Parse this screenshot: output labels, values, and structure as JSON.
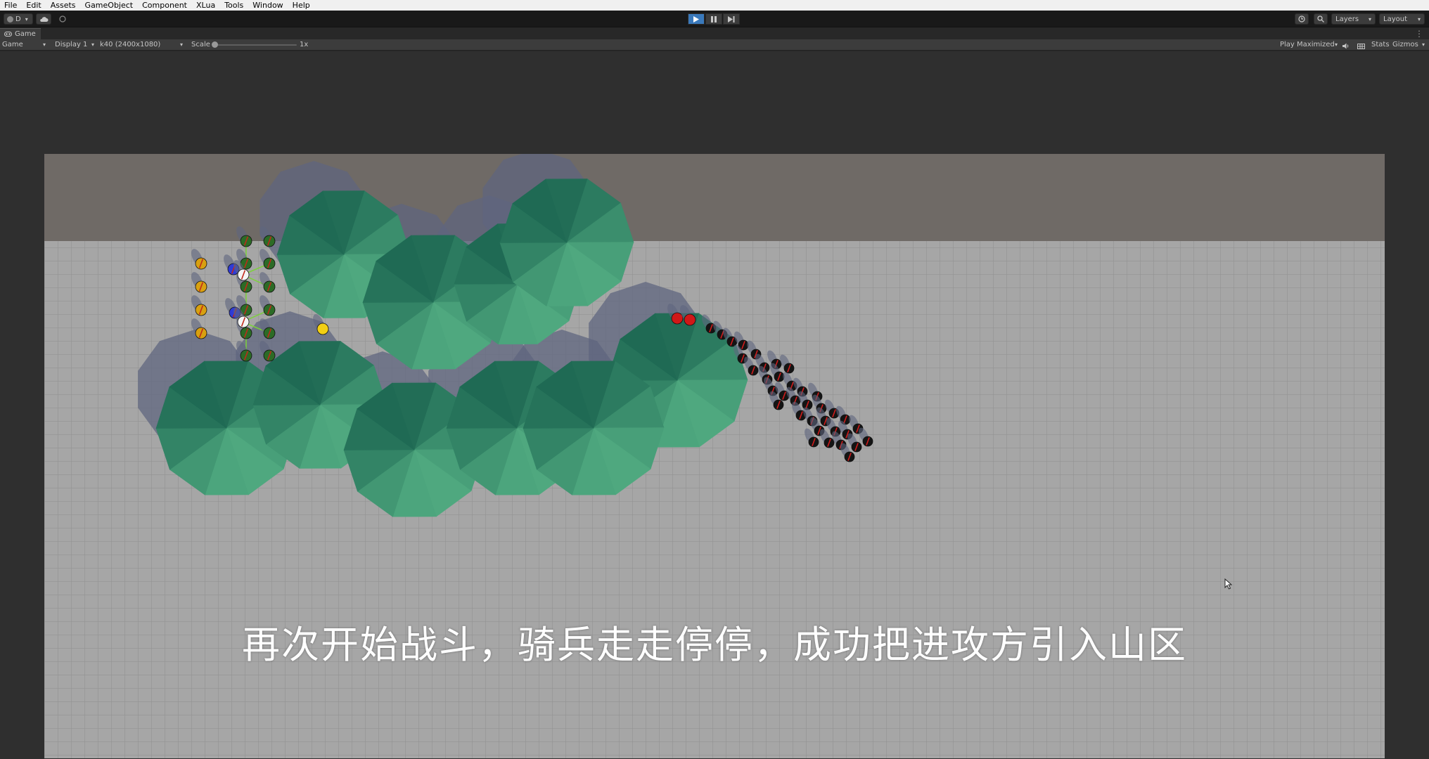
{
  "menu": [
    "File",
    "Edit",
    "Assets",
    "GameObject",
    "Component",
    "XLua",
    "Tools",
    "Window",
    "Help"
  ],
  "toolbar": {
    "account_label": "D",
    "layers_label": "Layers",
    "layout_label": "Layout"
  },
  "tab": {
    "label": "Game"
  },
  "gamebar": {
    "view_mode": "Game",
    "display": "Display 1",
    "resolution": "k40 (2400x1080)",
    "scale_label": "Scale",
    "scale_value": "1x",
    "play_mode": "Play Maximized",
    "stats_label": "Stats",
    "gizmos_label": "Gizmos"
  },
  "subtitle": "再次开始战斗，骑兵走走停停，成功把进攻方引入山区",
  "colors": {
    "mountain_light": "#4fa87f",
    "mountain_dark": "#1f6a54",
    "ground": "#a3a3a3",
    "sky_band": "#6f6a66",
    "enemy_unit": "#141414",
    "enemy_leader": "#d01818",
    "ally_unit": "#2c6b26",
    "ally_archer": "#d8a010",
    "ally_commander_blue": "#2f3bd6",
    "ally_commander_white": "#f4f4f4",
    "marker_yellow": "#f3cf14",
    "play_active": "#3a79bb"
  },
  "icons": [
    "account-icon",
    "cloud-icon",
    "collab-icon",
    "play-icon",
    "pause-icon",
    "step-icon",
    "history-icon",
    "search-icon",
    "game-tab-icon",
    "mute-icon",
    "grid-icon",
    "kebab-icon"
  ]
}
